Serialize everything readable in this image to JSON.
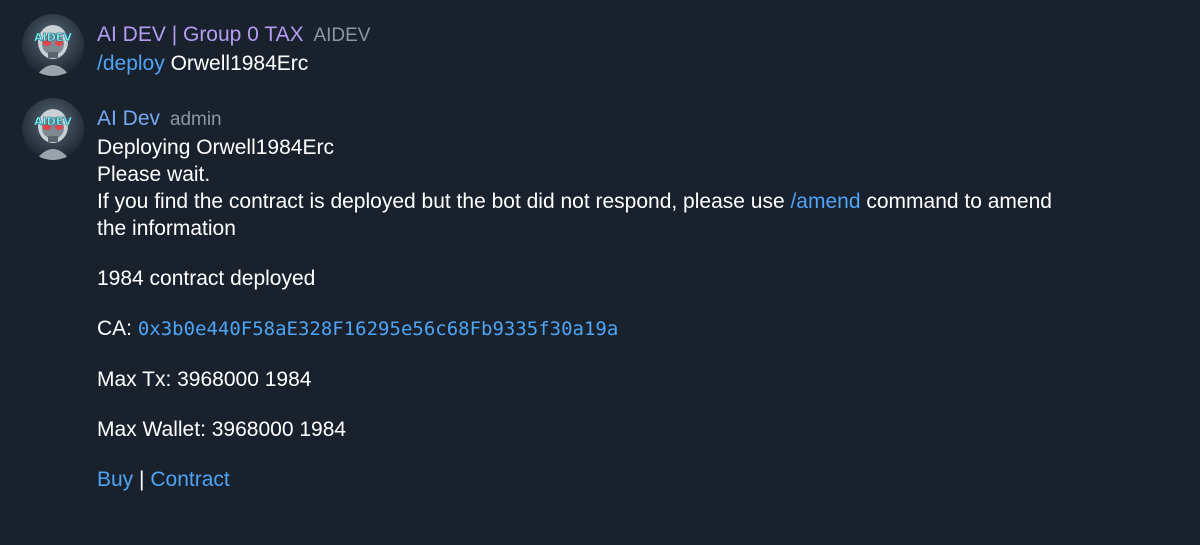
{
  "messages": [
    {
      "sender": "AI DEV | Group 0 TAX",
      "role": "AIDEV",
      "sender_color": "#b59cf2",
      "avatar_icon": "robot-avatar-icon",
      "avatar_text": "AIDEV",
      "command": "/deploy",
      "argument": "Orwell1984Erc"
    },
    {
      "sender": "AI Dev",
      "role": "admin",
      "sender_color": "#74a8f2",
      "avatar_icon": "robot-avatar-icon",
      "avatar_text": "AIDEV",
      "line1": "Deploying Orwell1984Erc",
      "line2": "Please wait.",
      "line3_before": "If you find the contract is deployed but the bot did not respond, please use ",
      "line3_link": "/amend",
      "line3_after": " command to amend",
      "line4": "the information",
      "deployed": "1984 contract deployed",
      "ca_label": "CA: ",
      "ca_address": "0x3b0e440F58aE328F16295e56c68Fb9335f30a19a",
      "max_tx": "Max Tx: 3968000 1984",
      "max_wallet": "Max Wallet: 3968000 1984",
      "buy_link": "Buy",
      "separator": "|",
      "contract_link": "Contract"
    }
  ],
  "colors": {
    "background": "#18212c",
    "link": "#4ea4f5",
    "role": "#8b96a3"
  }
}
